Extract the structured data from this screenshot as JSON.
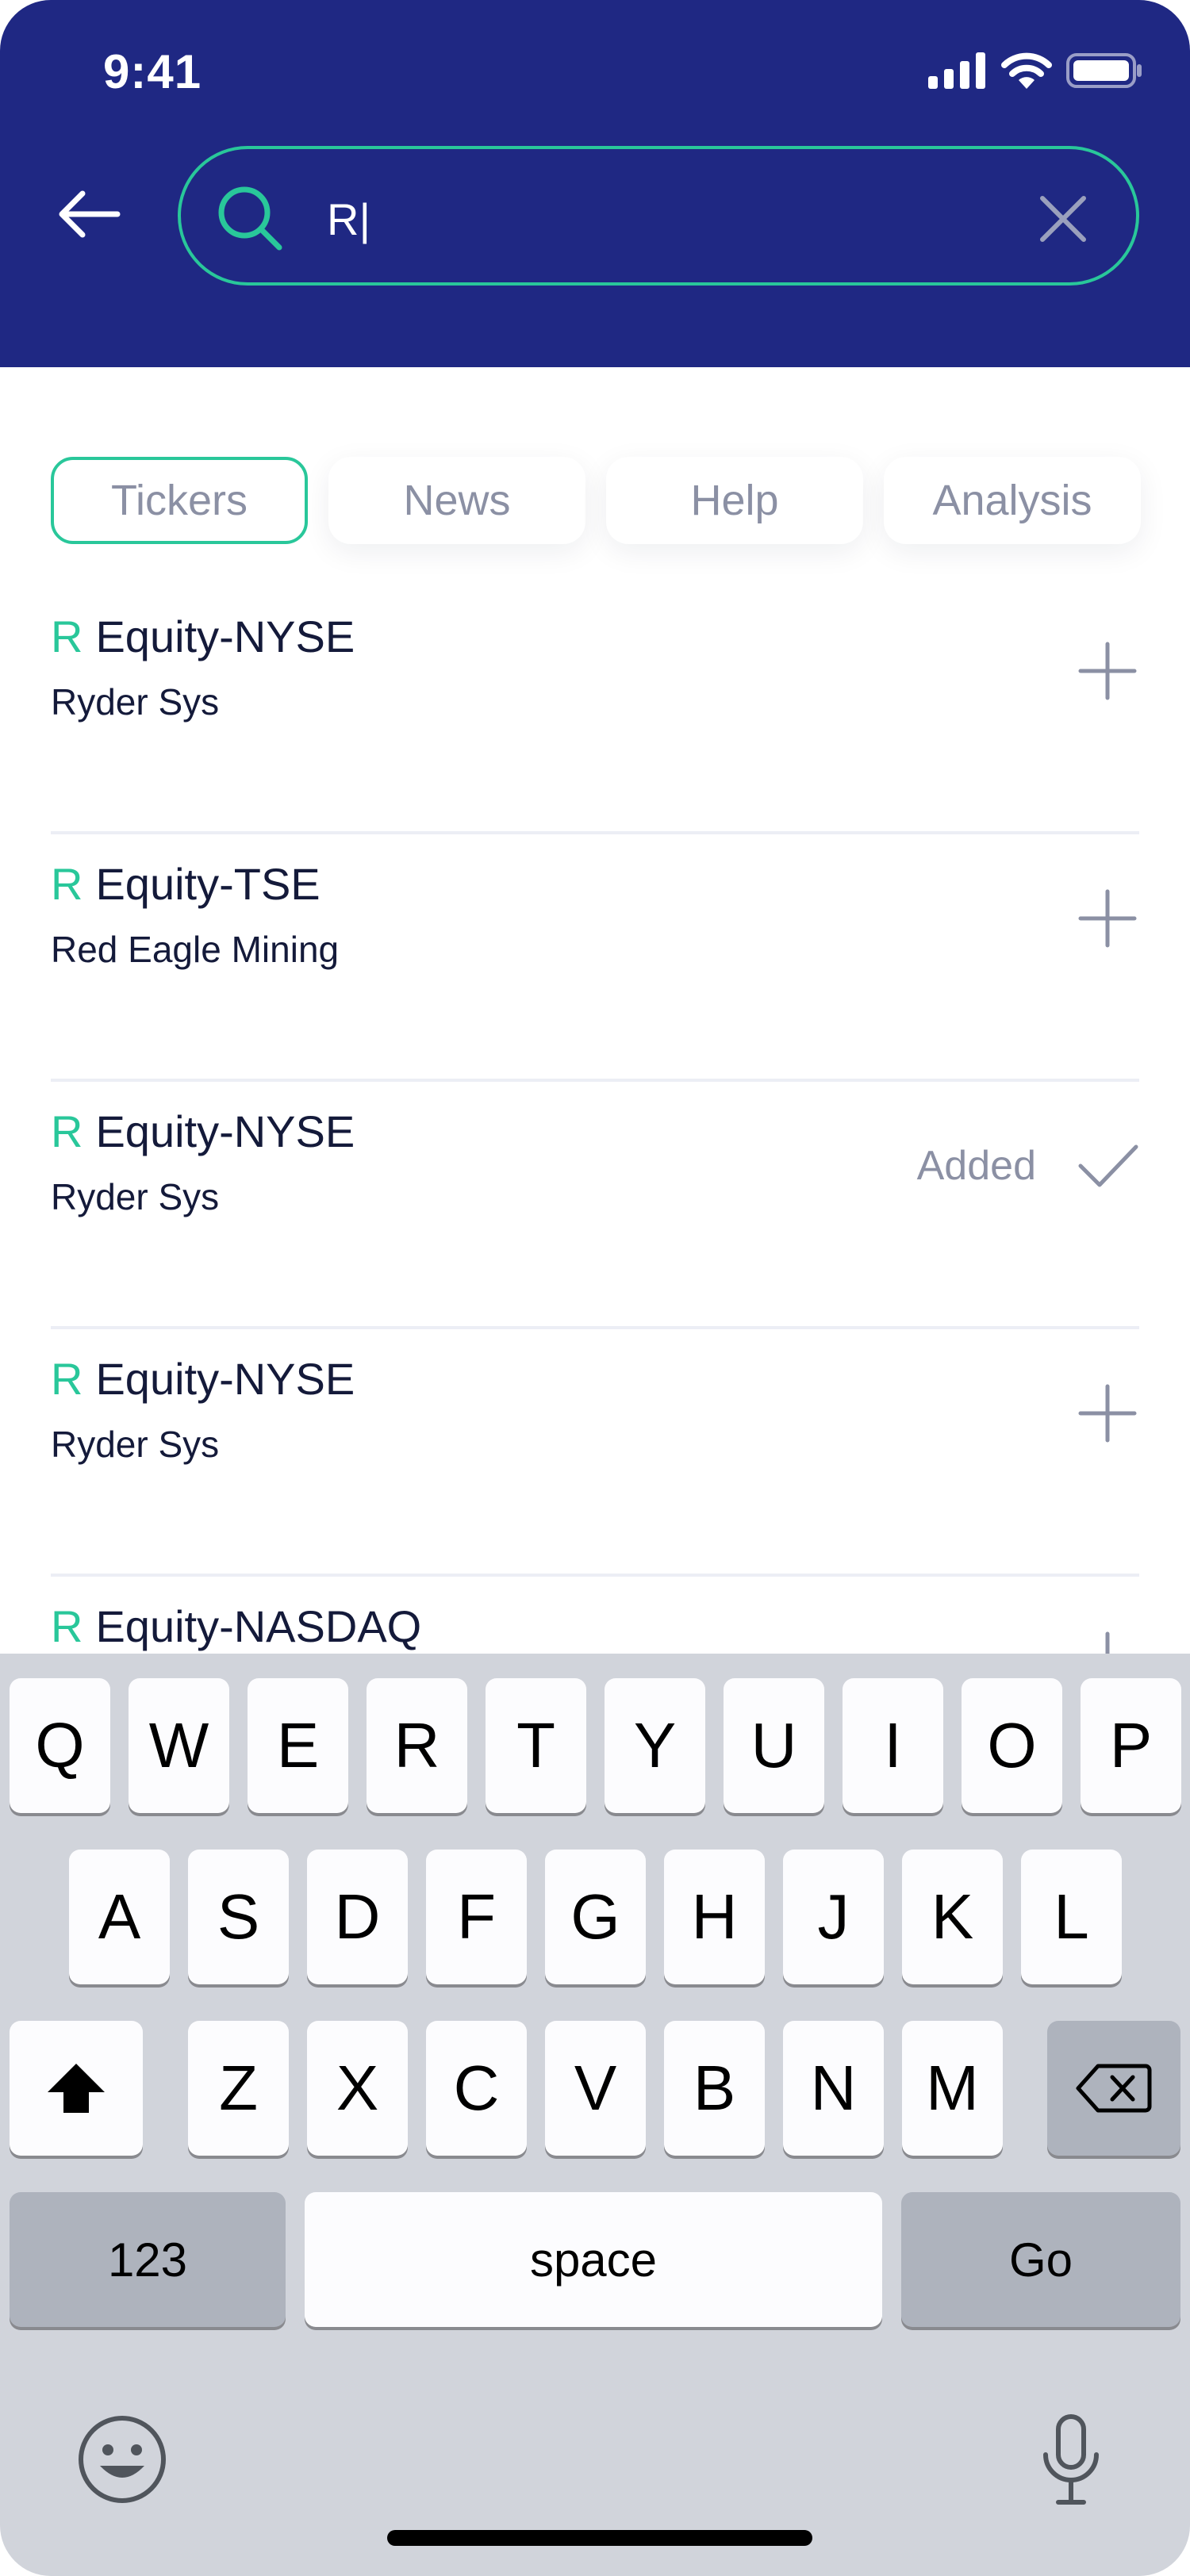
{
  "status_bar": {
    "time": "9:41"
  },
  "search": {
    "value": "R|",
    "placeholder": ""
  },
  "tabs": [
    {
      "label": "Tickers",
      "active": true
    },
    {
      "label": "News",
      "active": false
    },
    {
      "label": "Help",
      "active": false
    },
    {
      "label": "Analysis",
      "active": false
    }
  ],
  "results": [
    {
      "letter": "R",
      "title": "Equity-NYSE",
      "subtitle": "Ryder Sys",
      "action": "plus-icon"
    },
    {
      "letter": "R",
      "title": "Equity-TSE",
      "subtitle": "Red Eagle Mining",
      "action": "plus-icon"
    },
    {
      "letter": "R",
      "title": "Equity-NYSE",
      "subtitle": "Ryder Sys",
      "action": "check-icon",
      "added_label": "Added"
    },
    {
      "letter": "R",
      "title": "Equity-NYSE",
      "subtitle": "Ryder Sys",
      "action": "plus-icon"
    },
    {
      "letter": "R",
      "title": "Equity-NASDAQ",
      "subtitle": "",
      "action": "plus-icon"
    }
  ],
  "keyboard": {
    "row1": [
      "Q",
      "W",
      "E",
      "R",
      "T",
      "Y",
      "U",
      "I",
      "O",
      "P"
    ],
    "row2": [
      "A",
      "S",
      "D",
      "F",
      "G",
      "H",
      "J",
      "K",
      "L"
    ],
    "row3": [
      "Z",
      "X",
      "C",
      "V",
      "B",
      "N",
      "M"
    ],
    "numbers_label": "123",
    "space_label": "space",
    "go_label": "Go"
  },
  "colors": {
    "header": "#1f2883",
    "accent": "#29c79a",
    "muted": "#8b90a4",
    "keyboard_bg": "#d1d4db"
  }
}
